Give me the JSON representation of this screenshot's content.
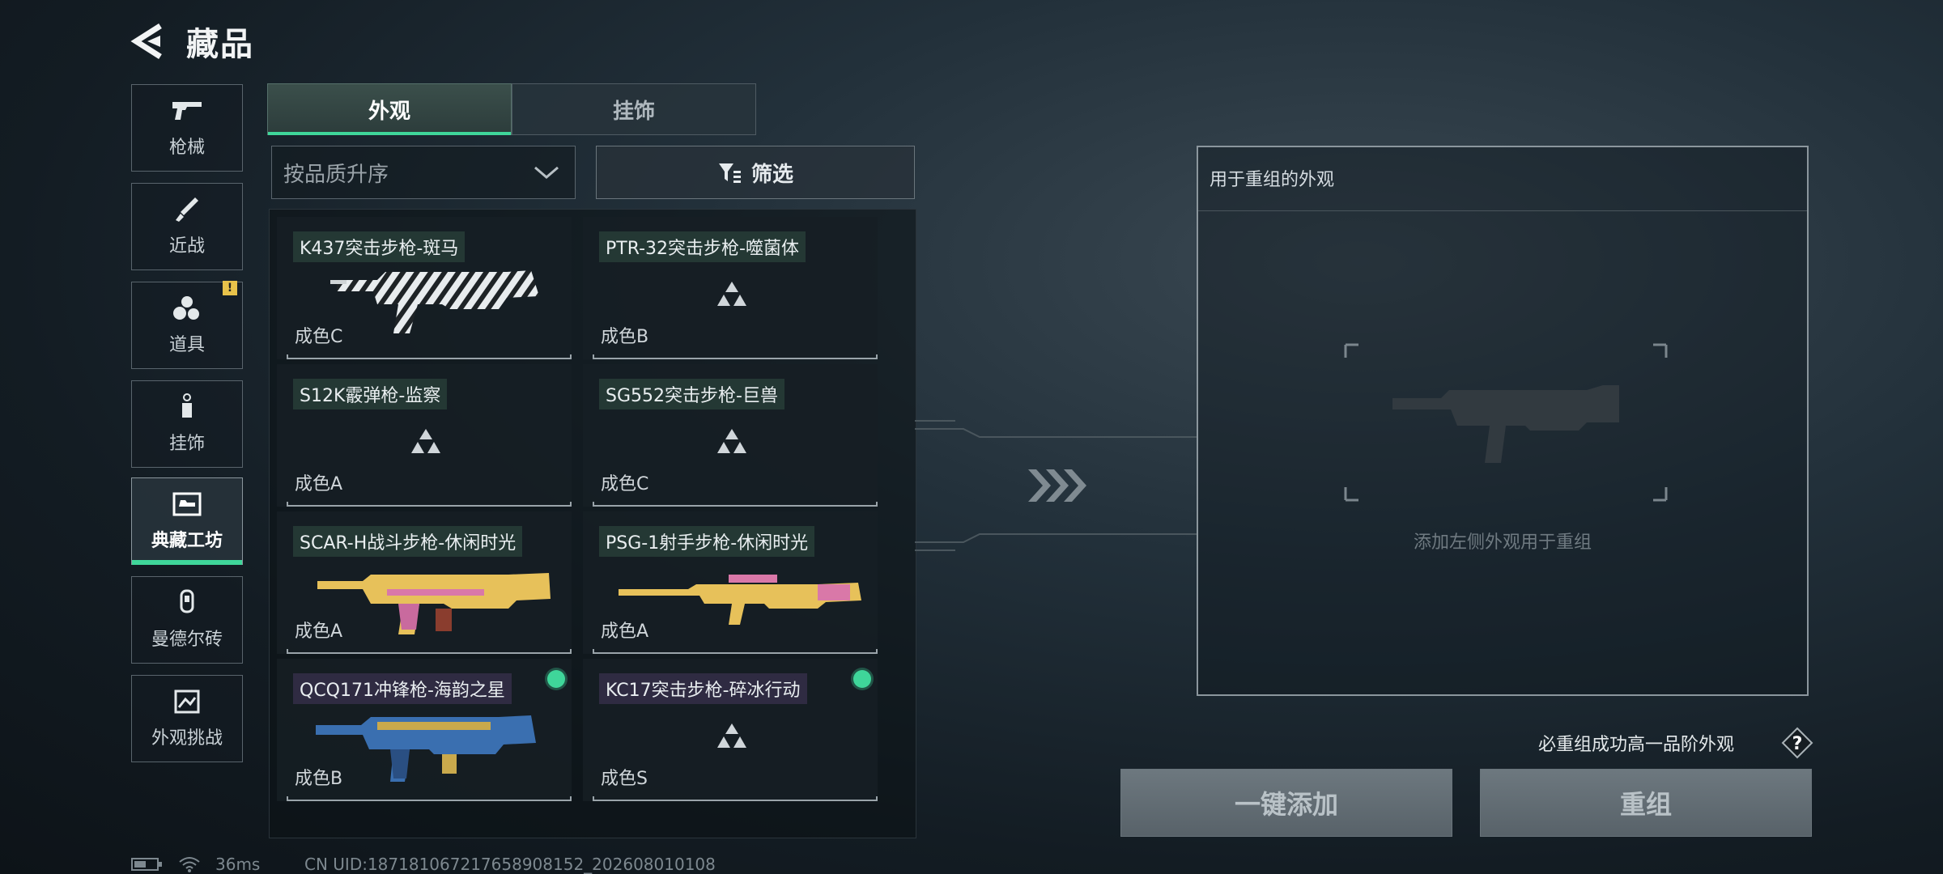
{
  "header": {
    "title": "藏品"
  },
  "sidebar": {
    "items": [
      {
        "label": "枪械",
        "icon": "gun-icon"
      },
      {
        "label": "近战",
        "icon": "knife-icon"
      },
      {
        "label": "道具",
        "icon": "grenade-icon",
        "badge": "!"
      },
      {
        "label": "挂饰",
        "icon": "charm-icon"
      },
      {
        "label": "典藏工坊",
        "icon": "workshop-icon",
        "active": true
      },
      {
        "label": "曼德尔砖",
        "icon": "brick-icon"
      },
      {
        "label": "外观挑战",
        "icon": "challenge-icon"
      }
    ]
  },
  "tabs": [
    {
      "label": "外观",
      "active": true
    },
    {
      "label": "挂饰",
      "active": false
    }
  ],
  "sort": {
    "label": "按品质升序"
  },
  "filter": {
    "label": "筛选"
  },
  "cards": [
    {
      "name": "K437突击步枪-斑马",
      "grade": "成色C",
      "image": "zebra-rifle",
      "dot": false
    },
    {
      "name": "PTR-32突击步枪-噬菌体",
      "grade": "成色B",
      "image": "placeholder",
      "dot": false
    },
    {
      "name": "S12K霰弹枪-监察",
      "grade": "成色A",
      "image": "placeholder",
      "dot": false
    },
    {
      "name": "SG552突击步枪-巨兽",
      "grade": "成色C",
      "image": "placeholder",
      "dot": false
    },
    {
      "name": "SCAR-H战斗步枪-休闲时光",
      "grade": "成色A",
      "image": "gold-rifle",
      "dot": false
    },
    {
      "name": "PSG-1射手步枪-休闲时光",
      "grade": "成色A",
      "image": "gold-sniper",
      "dot": false
    },
    {
      "name": "QCQ171冲锋枪-海韵之星",
      "grade": "成色B",
      "image": "blue-smg",
      "dot": true
    },
    {
      "name": "KC17突击步枪-碎冰行动",
      "grade": "成色S",
      "image": "placeholder",
      "dot": true
    }
  ],
  "panel": {
    "title": "用于重组的外观",
    "hint": "添加左侧外观用于重组"
  },
  "guarantee": {
    "text": "必重组成功高一品阶外观",
    "help": "?"
  },
  "buttons": {
    "add": "一键添加",
    "reforge": "重组"
  },
  "status": {
    "ping": "36ms",
    "uid": "CN UID:187181067217658908152_202608010108"
  },
  "colors": {
    "accent": "#3fd69a",
    "badge": "#e8c24a",
    "gold": "#e7c15a"
  }
}
